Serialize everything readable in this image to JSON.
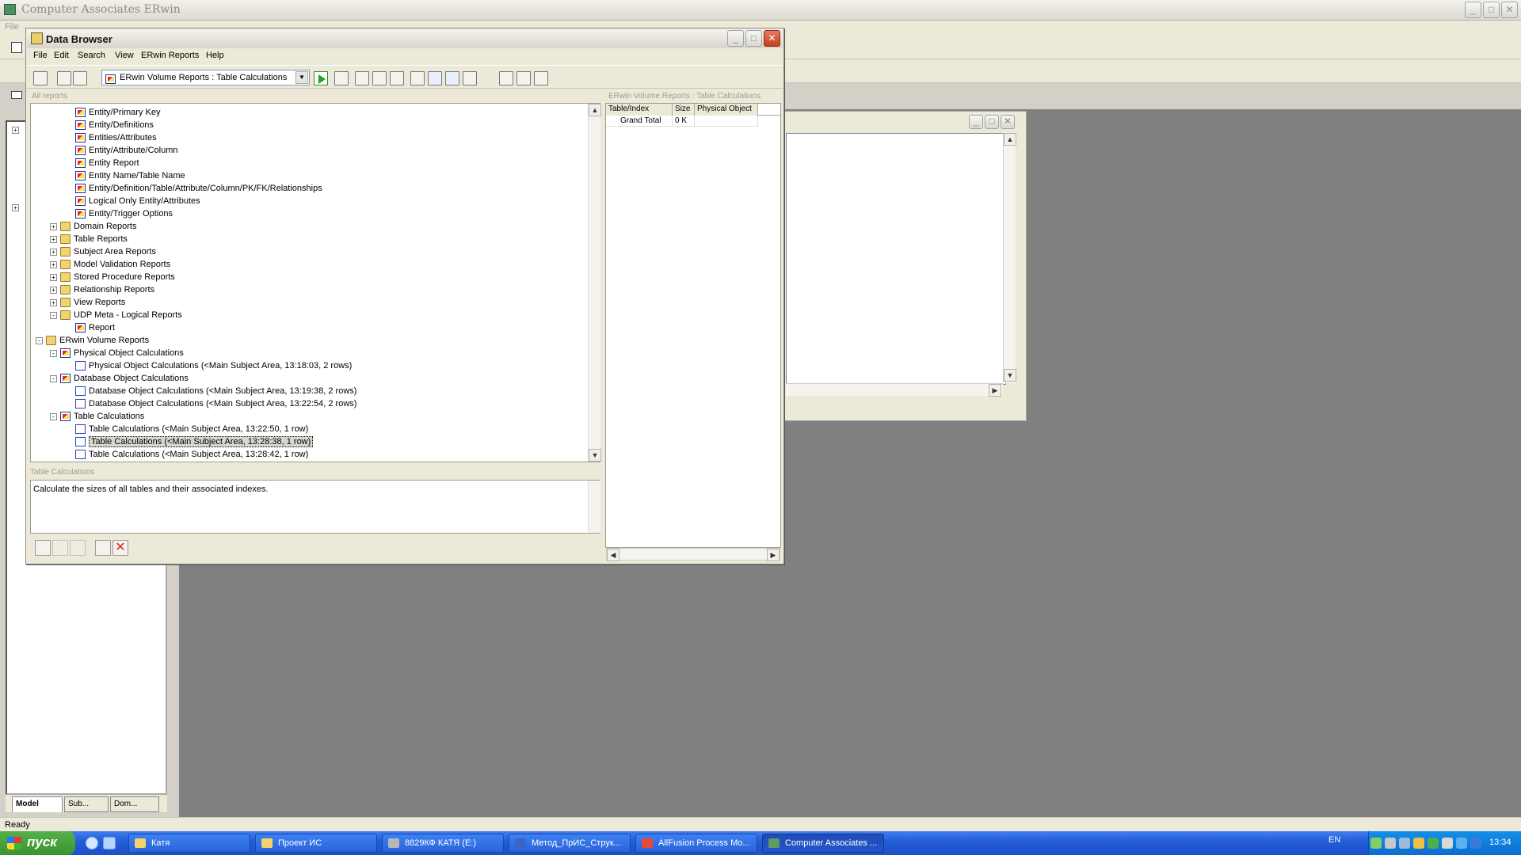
{
  "app": {
    "title": "Computer Associates ERwin",
    "menu_file": "File"
  },
  "data_browser": {
    "title": "Data Browser",
    "menu": [
      "File",
      "Edit",
      "Search",
      "View",
      "ERwin Reports",
      "Help"
    ],
    "report_select": "ERwin Volume Reports : Table Calculations",
    "tree_header": "All reports",
    "tree": [
      {
        "label": "Entity/Primary Key",
        "type": "report",
        "depth": 3
      },
      {
        "label": "Entity/Definitions",
        "type": "report",
        "depth": 3
      },
      {
        "label": "Entities/Attributes",
        "type": "report",
        "depth": 3
      },
      {
        "label": "Entity/Attribute/Column",
        "type": "report",
        "depth": 3
      },
      {
        "label": "Entity Report",
        "type": "report",
        "depth": 3
      },
      {
        "label": "Entity Name/Table Name",
        "type": "report",
        "depth": 3
      },
      {
        "label": "Entity/Definition/Table/Attribute/Column/PK/FK/Relationships",
        "type": "report",
        "depth": 3
      },
      {
        "label": "Logical Only Entity/Attributes",
        "type": "report",
        "depth": 3
      },
      {
        "label": "Entity/Trigger Options",
        "type": "report",
        "depth": 3
      },
      {
        "label": "Domain Reports",
        "type": "folder",
        "depth": 2,
        "toggle": "+"
      },
      {
        "label": "Table Reports",
        "type": "folder",
        "depth": 2,
        "toggle": "+"
      },
      {
        "label": "Subject Area Reports",
        "type": "folder",
        "depth": 2,
        "toggle": "+"
      },
      {
        "label": "Model Validation Reports",
        "type": "folder",
        "depth": 2,
        "toggle": "+"
      },
      {
        "label": "Stored Procedure Reports",
        "type": "folder",
        "depth": 2,
        "toggle": "+"
      },
      {
        "label": "Relationship Reports",
        "type": "folder",
        "depth": 2,
        "toggle": "+"
      },
      {
        "label": "View Reports",
        "type": "folder",
        "depth": 2,
        "toggle": "+"
      },
      {
        "label": "UDP Meta - Logical Reports",
        "type": "folder",
        "depth": 2,
        "toggle": "-"
      },
      {
        "label": "Report",
        "type": "report",
        "depth": 3
      },
      {
        "label": "ERwin Volume Reports",
        "type": "folder",
        "depth": 1,
        "toggle": "-"
      },
      {
        "label": "Physical Object Calculations",
        "type": "report",
        "depth": 2,
        "toggle": "-"
      },
      {
        "label": "Physical Object Calculations   (<Main Subject Area,  13:18:03, 2 rows)",
        "type": "doc",
        "depth": 3
      },
      {
        "label": "Database Object Calculations",
        "type": "report",
        "depth": 2,
        "toggle": "-"
      },
      {
        "label": "Database Object Calculations   (<Main Subject Area,  13:19:38, 2 rows)",
        "type": "doc",
        "depth": 3
      },
      {
        "label": "Database Object Calculations   (<Main Subject Area,  13:22:54, 2 rows)",
        "type": "doc",
        "depth": 3
      },
      {
        "label": "Table Calculations",
        "type": "report",
        "depth": 2,
        "toggle": "-"
      },
      {
        "label": "Table Calculations   (<Main Subject Area,  13:22:50, 1 row)",
        "type": "doc",
        "depth": 3
      },
      {
        "label": "Table Calculations   (<Main Subject Area,  13:28:38, 1 row)",
        "type": "doc",
        "depth": 3,
        "selected": true
      },
      {
        "label": "Table Calculations   (<Main Subject Area,  13:28:42, 1 row)",
        "type": "doc",
        "depth": 3
      }
    ],
    "desc_header": "Table Calculations",
    "description": "Calculate the sizes of all tables and their associated indexes.",
    "results_header": "ERwin Volume Reports : Table Calculations",
    "results_columns": [
      "Table/Index",
      "Size",
      "Physical Object"
    ],
    "results_row": [
      "Grand Total",
      "0 K",
      ""
    ]
  },
  "explorer_tabs": [
    "Model",
    "Sub...",
    "Dom..."
  ],
  "status": "Ready",
  "taskbar": {
    "start": "пуск",
    "tasks": [
      {
        "label": "Катя",
        "color": "#f4d36b"
      },
      {
        "label": "Проект ИС",
        "color": "#f4d36b"
      },
      {
        "label": "8829КФ КАТЯ (E:)",
        "color": "#b8b8b8"
      },
      {
        "label": "Метод_ПрИС_Струк...",
        "color": "#3a64c8"
      },
      {
        "label": "AllFusion Process Mo...",
        "color": "#e84a3a"
      },
      {
        "label": "Computer Associates ...",
        "color": "#5e9a66",
        "active": true
      }
    ],
    "lang": "EN",
    "clock": "13:34"
  }
}
